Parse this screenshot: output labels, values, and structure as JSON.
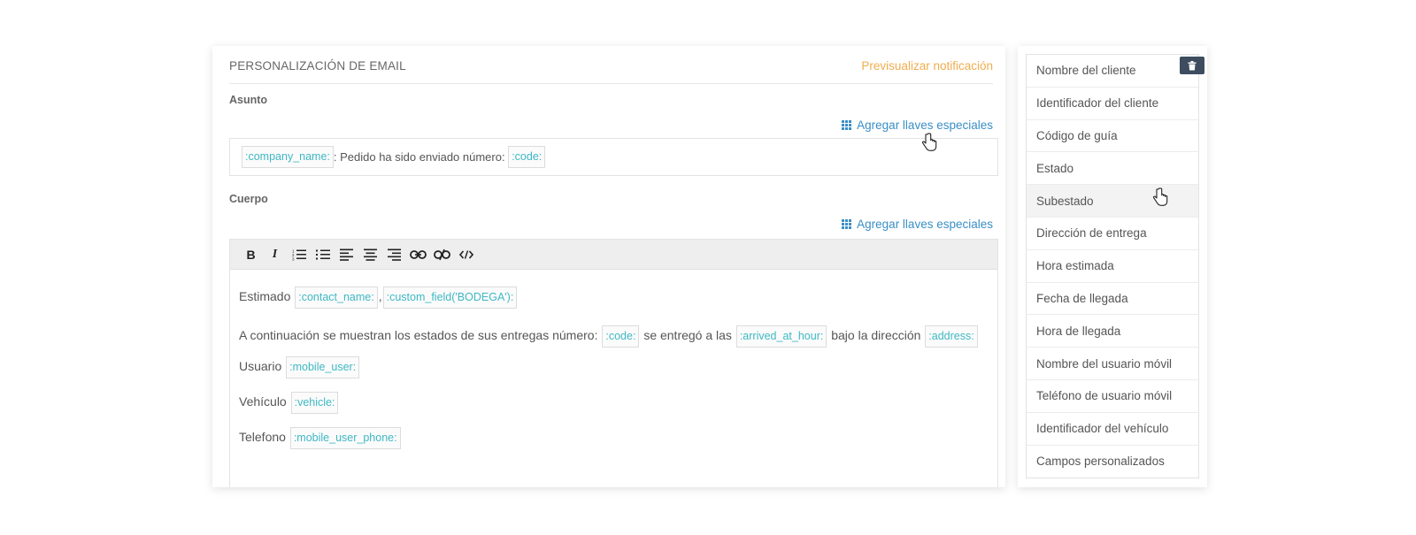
{
  "email": {
    "title": "PERSONALIZACIÓN DE EMAIL",
    "preview_link": "Previsualizar notificación",
    "subject": {
      "label": "Asunto",
      "keys_link": "Agregar llaves especiales",
      "tag_company": ":company_name:",
      "text_1": ": Pedido ha sido enviado número:",
      "tag_code": ":code:"
    },
    "body": {
      "label": "Cuerpo",
      "keys_link": "Agregar llaves especiales",
      "line1": {
        "text_1": "Estimado",
        "tag_1": ":contact_name:",
        "sep": ",",
        "tag_2": ":custom_field('BODEGA'):"
      },
      "line2": {
        "text_1": "A continuación se muestran los estados de sus entregas número:",
        "tag_1": ":code:",
        "text_2": "se entregó a las",
        "tag_2": ":arrived_at_hour:",
        "text_3": "bajo la dirección",
        "tag_3": ":address:"
      },
      "line3": {
        "text_1": "Usuario",
        "tag_1": ":mobile_user:"
      },
      "line4": {
        "text_1": "Vehículo",
        "tag_1": ":vehicle:"
      },
      "line5": {
        "text_1": "Telefono",
        "tag_1": ":mobile_user_phone:"
      }
    },
    "toolbar": {
      "bold": "B",
      "italic": "I"
    }
  },
  "special_keys": {
    "items": [
      "Nombre del cliente",
      "Identificador del cliente",
      "Código de guía",
      "Estado",
      "Subestado",
      "Dirección de entrega",
      "Hora estimada",
      "Fecha de llegada",
      "Hora de llegada",
      "Nombre del usuario móvil",
      "Teléfono de usuario móvil",
      "Identificador del vehículo",
      "Campos personalizados"
    ],
    "hovered_item": "Subestado"
  },
  "colors": {
    "accent_orange": "#f0ad4e",
    "link_blue": "#3a8fc7",
    "tag_teal": "#3fb8c4",
    "trash_button": "#3d4d5f"
  },
  "icons": [
    "grid-icon",
    "trash-icon",
    "hand-cursor-icon",
    "bold-icon",
    "italic-icon",
    "ordered-list-icon",
    "unordered-list-icon",
    "align-left-icon",
    "align-center-icon",
    "align-right-icon",
    "link-icon",
    "unlink-icon",
    "code-view-icon"
  ]
}
